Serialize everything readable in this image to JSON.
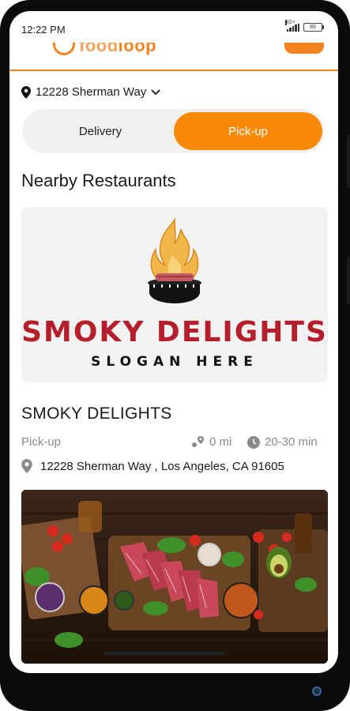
{
  "status_bar": {
    "time": "12:22 PM",
    "network": "4G+",
    "battery": "85"
  },
  "header": {
    "logo_text_a": "food",
    "logo_text_b": "loop"
  },
  "location": {
    "address": "12228 Sherman Way"
  },
  "mode_toggle": {
    "delivery_label": "Delivery",
    "pickup_label": "Pick-up",
    "selected": "Pick-up"
  },
  "section": {
    "title": "Nearby Restaurants"
  },
  "restaurant": {
    "logo_brand": "SMOKY DELIGHTS",
    "logo_slogan": "SLOGAN HERE",
    "name": "SMOKY DELIGHTS",
    "mode": "Pick-up",
    "distance": "0 mi",
    "eta": "20-30 min",
    "full_address": "12228 Sherman Way , Los Angeles, CA 91605"
  },
  "colors": {
    "accent": "#f98a08",
    "brand_red": "#b51f2b",
    "text": "#1a1a1a",
    "muted": "#8a8a8a"
  }
}
